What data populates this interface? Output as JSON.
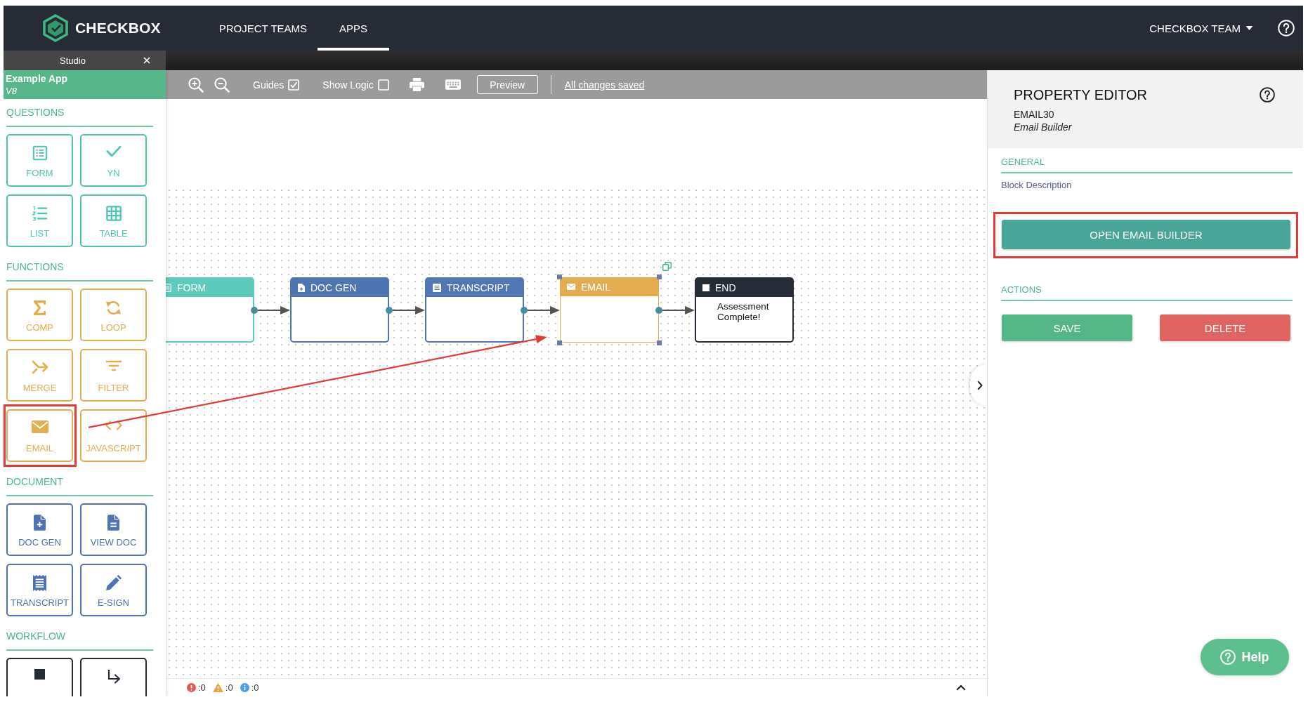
{
  "top_nav": {
    "logo_text": "CHECKBOX",
    "tabs": [
      {
        "label": "PROJECT TEAMS",
        "selected": false
      },
      {
        "label": "APPS",
        "selected": true
      }
    ],
    "account_menu": "CHECKBOX TEAM"
  },
  "studio_tab": {
    "title": "Studio"
  },
  "sidebar": {
    "app_name": "Example App",
    "app_version": "V8",
    "sections": [
      {
        "title": "QUESTIONS",
        "color": "#4dc4b4",
        "tiles": [
          {
            "label": "FORM",
            "highlighted": false
          },
          {
            "label": "YN",
            "highlighted": false
          },
          {
            "label": "LIST",
            "highlighted": false
          },
          {
            "label": "TABLE",
            "highlighted": false
          }
        ]
      },
      {
        "title": "FUNCTIONS",
        "color": "#e4ad52",
        "tiles": [
          {
            "label": "COMP",
            "highlighted": false
          },
          {
            "label": "LOOP",
            "highlighted": false
          },
          {
            "label": "MERGE",
            "highlighted": false
          },
          {
            "label": "FILTER",
            "highlighted": false
          },
          {
            "label": "EMAIL",
            "highlighted": true
          },
          {
            "label": "JAVASCRIPT",
            "highlighted": false
          }
        ]
      },
      {
        "title": "DOCUMENT",
        "color": "#4f73b1",
        "tiles": [
          {
            "label": "DOC GEN",
            "highlighted": false
          },
          {
            "label": "VIEW DOC",
            "highlighted": false
          },
          {
            "label": "TRANSCRIPT",
            "highlighted": false
          },
          {
            "label": "E-SIGN",
            "highlighted": false
          }
        ]
      },
      {
        "title": "WORKFLOW",
        "color": "#262c37",
        "tiles": [
          {
            "highlighted": false
          },
          {
            "highlighted": false
          }
        ]
      }
    ]
  },
  "toolbar": {
    "options": [
      {
        "label": "Guides",
        "checked": true
      },
      {
        "label": "Show Logic",
        "checked": false
      }
    ],
    "preview_button": "Preview",
    "save_status": "All changes saved"
  },
  "canvas": {
    "nodes": [
      {
        "title": "FORM",
        "color": "#5ecabb",
        "selected": false
      },
      {
        "title": "DOC GEN",
        "color": "#4e74b1",
        "selected": false
      },
      {
        "title": "TRANSCRIPT",
        "color": "#5276b3",
        "selected": false
      },
      {
        "title": "EMAIL",
        "color": "#e3ac50",
        "selected": true
      },
      {
        "title": "END",
        "color": "#262c37",
        "selected": false,
        "body": "Assessment Complete!"
      }
    ]
  },
  "status_bar": {
    "counts": [
      {
        "kind": "error",
        "text": ":0"
      },
      {
        "kind": "warning",
        "text": ":0"
      },
      {
        "kind": "info",
        "text": ":0"
      }
    ]
  },
  "property_editor": {
    "title": "PROPERTY EDITOR",
    "block_id": "EMAIL30",
    "block_type": "Email Builder",
    "general": {
      "title": "GENERAL",
      "field_label": "Block Description",
      "button": {
        "label": "OPEN EMAIL BUILDER",
        "highlighted": true
      }
    },
    "actions": {
      "title": "ACTIONS",
      "buttons": [
        {
          "label": "SAVE",
          "kind": "save"
        },
        {
          "label": "DELETE",
          "kind": "delete"
        }
      ]
    }
  },
  "help_button": {
    "label": "Help"
  }
}
